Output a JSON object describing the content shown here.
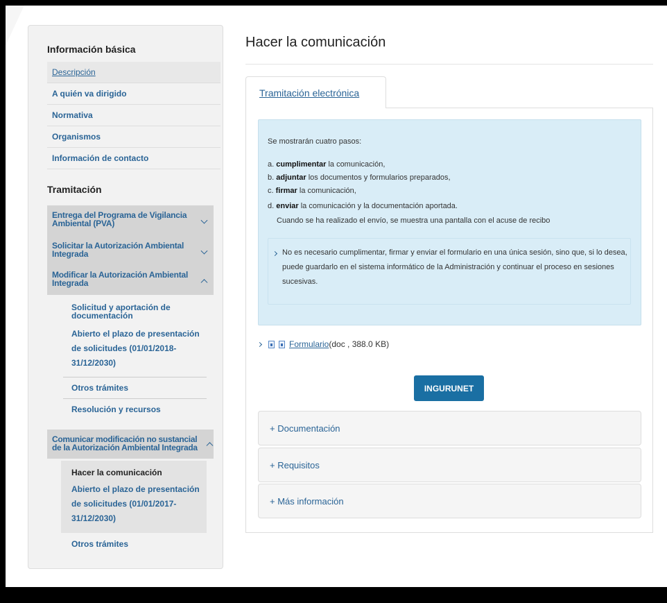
{
  "sidebar": {
    "basic_heading": "Información básica",
    "basic_items": [
      {
        "label": "Descripción"
      },
      {
        "label": "A quién va dirigido"
      },
      {
        "label": "Normativa"
      },
      {
        "label": "Organismos"
      },
      {
        "label": "Información de contacto"
      }
    ],
    "tramitacion_heading": "Tramitación",
    "groups": [
      {
        "label": "Entrega del Programa de Vigilancia Ambiental (PVA)"
      },
      {
        "label": "Solicitar la Autorización Ambiental Integrada"
      },
      {
        "label": "Modificar la Autorización Ambiental Integrada"
      },
      {
        "label": "Comunicar modificación no sustancial de la Autorización Ambiental Integrada"
      }
    ],
    "modificar_subitems": [
      {
        "label": "Solicitud y aportación de documentación"
      },
      {
        "label": "Abierto el plazo de presentación de solicitudes (01/01/2018-31/12/2030)"
      },
      {
        "label": "Otros trámites"
      },
      {
        "label": "Resolución y recursos"
      }
    ],
    "comunicar_subitems": [
      {
        "label": "Hacer la comunicación"
      },
      {
        "label": "Abierto el plazo de presentación de solicitudes (01/01/2017-31/12/2030)"
      },
      {
        "label": "Otros trámites"
      }
    ]
  },
  "main": {
    "title": "Hacer la comunicación",
    "tab_label": "Tramitación electrónica",
    "info": {
      "intro": "Se mostrarán cuatro pasos:",
      "steps": [
        {
          "prefix": "a.",
          "bold": "cumplimentar",
          "rest": " la comunicación,"
        },
        {
          "prefix": "b.",
          "bold": "adjuntar",
          "rest": " los documentos y formularios preparados,"
        },
        {
          "prefix": "c.",
          "bold": "firmar",
          "rest": " la comunicación,"
        },
        {
          "prefix": "d.",
          "bold": "enviar",
          "rest": " la comunicación y la documentación aportada."
        }
      ],
      "after_send": "Cuando se ha realizado el envío, se muestra una pantalla con el acuse de recibo",
      "note": "No es necesario cumplimentar, firmar y enviar el formulario en una única sesión, sino que, si lo desea, puede guardarlo en el sistema informático de la Administración y continuar el proceso en sesiones sucesivas."
    },
    "form_link": "Formulario ",
    "form_meta": "(doc , 388.0 KB)",
    "ingurunet_label": "INGURUNET",
    "accordions": [
      {
        "label": "+ Documentación"
      },
      {
        "label": "+ Requisitos"
      },
      {
        "label": "+ Más información"
      }
    ]
  }
}
